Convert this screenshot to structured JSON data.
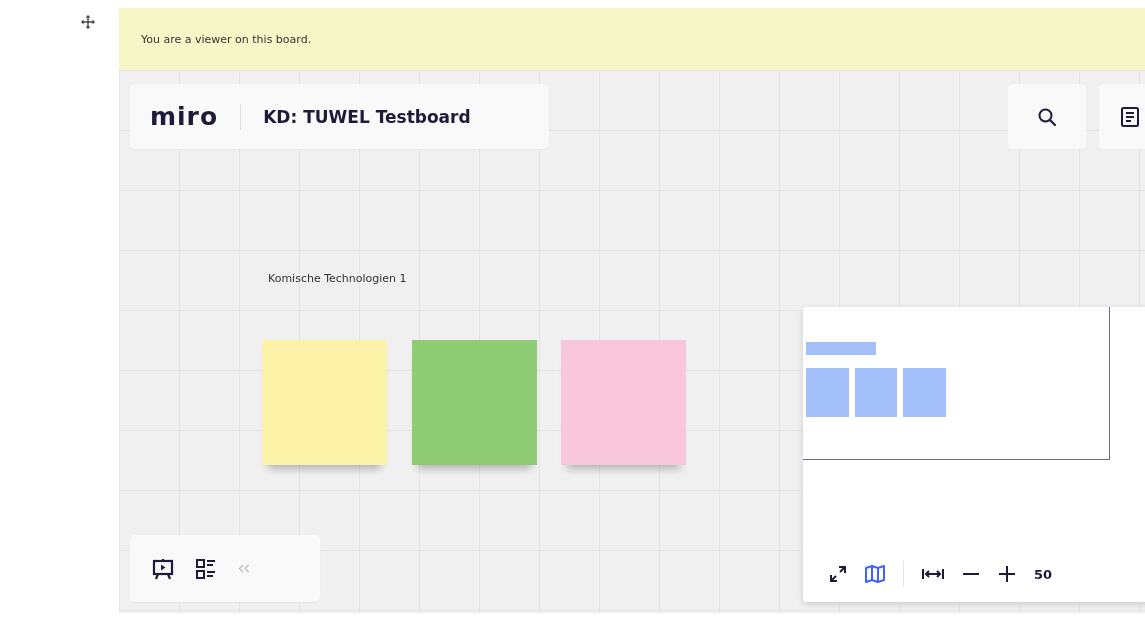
{
  "banner": {
    "text": "You are a viewer on this board."
  },
  "header": {
    "logo": "miro",
    "board_title": "KD: TUWEL Testboard"
  },
  "frame": {
    "label": "Komische Technologien 1"
  },
  "sticky_notes": [
    {
      "color": "#fbf2a8"
    },
    {
      "color": "#8ecb72"
    },
    {
      "color": "#f8c8da"
    }
  ],
  "minimap": {
    "map_selected": true,
    "zoom": "50"
  }
}
